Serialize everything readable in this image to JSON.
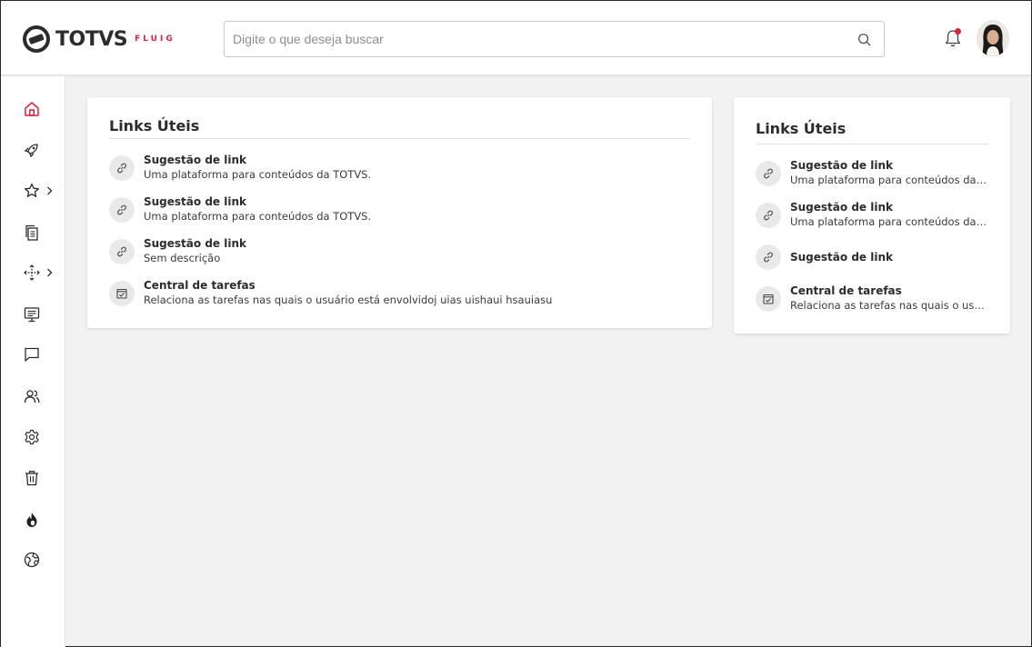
{
  "header": {
    "logo_text": "TOTVS",
    "logo_subtext": "FLUIG",
    "brand_color": "#e0203f",
    "search": {
      "placeholder": "Digite o que deseja buscar",
      "value": ""
    },
    "notification_icon": "bell-icon",
    "has_notification": true,
    "user_avatar": "avatar"
  },
  "sidebar": {
    "items": [
      {
        "icon": "home-icon",
        "active": true,
        "has_submenu": false
      },
      {
        "icon": "rocket-icon",
        "active": false,
        "has_submenu": false
      },
      {
        "icon": "star-icon",
        "active": false,
        "has_submenu": true
      },
      {
        "icon": "documents-icon",
        "active": false,
        "has_submenu": false
      },
      {
        "icon": "workflow-icon",
        "active": false,
        "has_submenu": true
      },
      {
        "icon": "presentation-icon",
        "active": false,
        "has_submenu": false
      },
      {
        "icon": "chat-icon",
        "active": false,
        "has_submenu": false
      },
      {
        "icon": "users-icon",
        "active": false,
        "has_submenu": false
      },
      {
        "icon": "gear-icon",
        "active": false,
        "has_submenu": false
      },
      {
        "icon": "trash-icon",
        "active": false,
        "has_submenu": false
      },
      {
        "icon": "fire-icon",
        "active": false,
        "has_submenu": false
      },
      {
        "icon": "globe-icon",
        "active": false,
        "has_submenu": false
      }
    ]
  },
  "widgets": [
    {
      "title": "Links Úteis",
      "links": [
        {
          "icon": "link-icon",
          "title": "Sugestão de link",
          "description": "Uma plataforma para conteúdos da TOTVS."
        },
        {
          "icon": "link-icon",
          "title": "Sugestão de link",
          "description": "Uma plataforma para conteúdos da TOTVS."
        },
        {
          "icon": "link-icon",
          "title": "Sugestão de link",
          "description": "Sem descrição"
        },
        {
          "icon": "task-check-icon",
          "title": "Central de tarefas",
          "description": "Relaciona as tarefas nas quais o usuário está envolvidoj uias uishaui hsauiasu"
        }
      ]
    },
    {
      "title": "Links Úteis",
      "links": [
        {
          "icon": "link-icon",
          "title": "Sugestão de link",
          "description": "Uma plataforma para conteúdos da T..."
        },
        {
          "icon": "link-icon",
          "title": "Sugestão de link",
          "description": "Uma plataforma para conteúdos da T..."
        },
        {
          "icon": "link-icon",
          "title": "Sugestão de link",
          "description": ""
        },
        {
          "icon": "task-check-icon",
          "title": "Central de tarefas",
          "description": "Relaciona as tarefas nas quais o usuá..."
        }
      ]
    }
  ]
}
